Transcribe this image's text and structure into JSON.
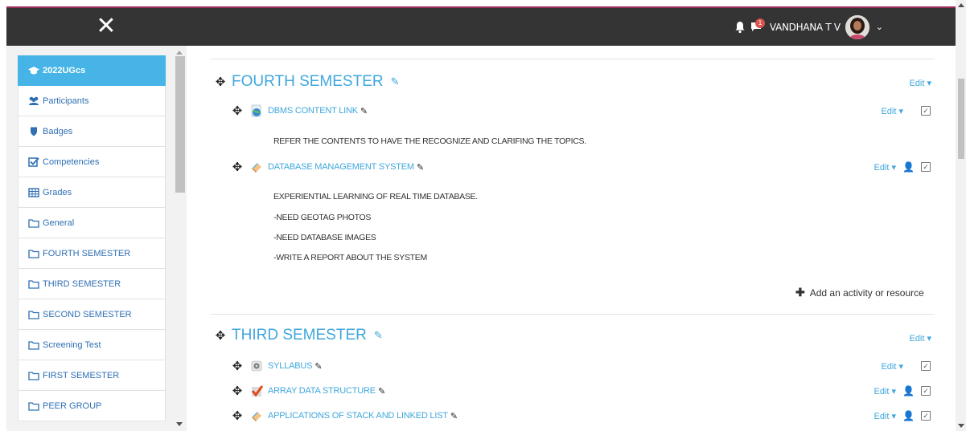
{
  "navbar": {
    "close_glyph": "✕",
    "message_count": "1",
    "username": "VANDHANA T V",
    "chevron": "⌄"
  },
  "drawer": {
    "items": [
      {
        "label": "2022UGcs",
        "icon": "graduation-cap-icon",
        "active": true
      },
      {
        "label": "Participants",
        "icon": "users-icon"
      },
      {
        "label": "Badges",
        "icon": "shield-icon"
      },
      {
        "label": "Competencies",
        "icon": "checkbox-icon"
      },
      {
        "label": "Grades",
        "icon": "table-icon"
      },
      {
        "label": "General",
        "icon": "folder-icon"
      },
      {
        "label": "FOURTH SEMESTER",
        "icon": "folder-icon"
      },
      {
        "label": "THIRD SEMESTER",
        "icon": "folder-icon"
      },
      {
        "label": "SECOND SEMESTER",
        "icon": "folder-icon"
      },
      {
        "label": "Screening Test",
        "icon": "folder-icon"
      },
      {
        "label": "FIRST SEMESTER",
        "icon": "folder-icon"
      },
      {
        "label": "PEER GROUP",
        "icon": "folder-icon"
      }
    ]
  },
  "sections": [
    {
      "title": "FOURTH SEMESTER",
      "edit": "Edit ▾",
      "activities": [
        {
          "name": "DBMS CONTENT LINK",
          "icon": "url-icon",
          "edit": "Edit ▾",
          "description": [
            "REFER THE CONTENTS TO HAVE THE RECOGNIZE AND CLARIFING THE TOPICS."
          ]
        },
        {
          "name": "DATABASE MANAGEMENT SYSTEM",
          "icon": "assignment-icon",
          "edit": "Edit ▾",
          "description": [
            "EXPERIENTIAL LEARNING OF REAL TIME DATABASE.",
            "-NEED GEOTAG PHOTOS",
            "-NEED DATABASE IMAGES",
            "-WRITE A REPORT ABOUT THE SYSTEM"
          ]
        }
      ],
      "add_activity": "Add an activity or resource"
    },
    {
      "title": "THIRD SEMESTER",
      "edit": "Edit ▾",
      "activities": [
        {
          "name": "SYLLABUS",
          "icon": "file-icon",
          "edit": "Edit ▾"
        },
        {
          "name": "ARRAY DATA STRUCTURE",
          "icon": "quiz-icon",
          "edit": "Edit ▾"
        },
        {
          "name": "APPLICATIONS OF STACK AND LINKED LIST",
          "icon": "assignment-icon",
          "edit": "Edit ▾"
        }
      ]
    }
  ],
  "colors": {
    "accent": "#9a2c5a",
    "navbar": "#343434",
    "link": "#3fa7dc",
    "active_drawer": "#46b4e6"
  }
}
